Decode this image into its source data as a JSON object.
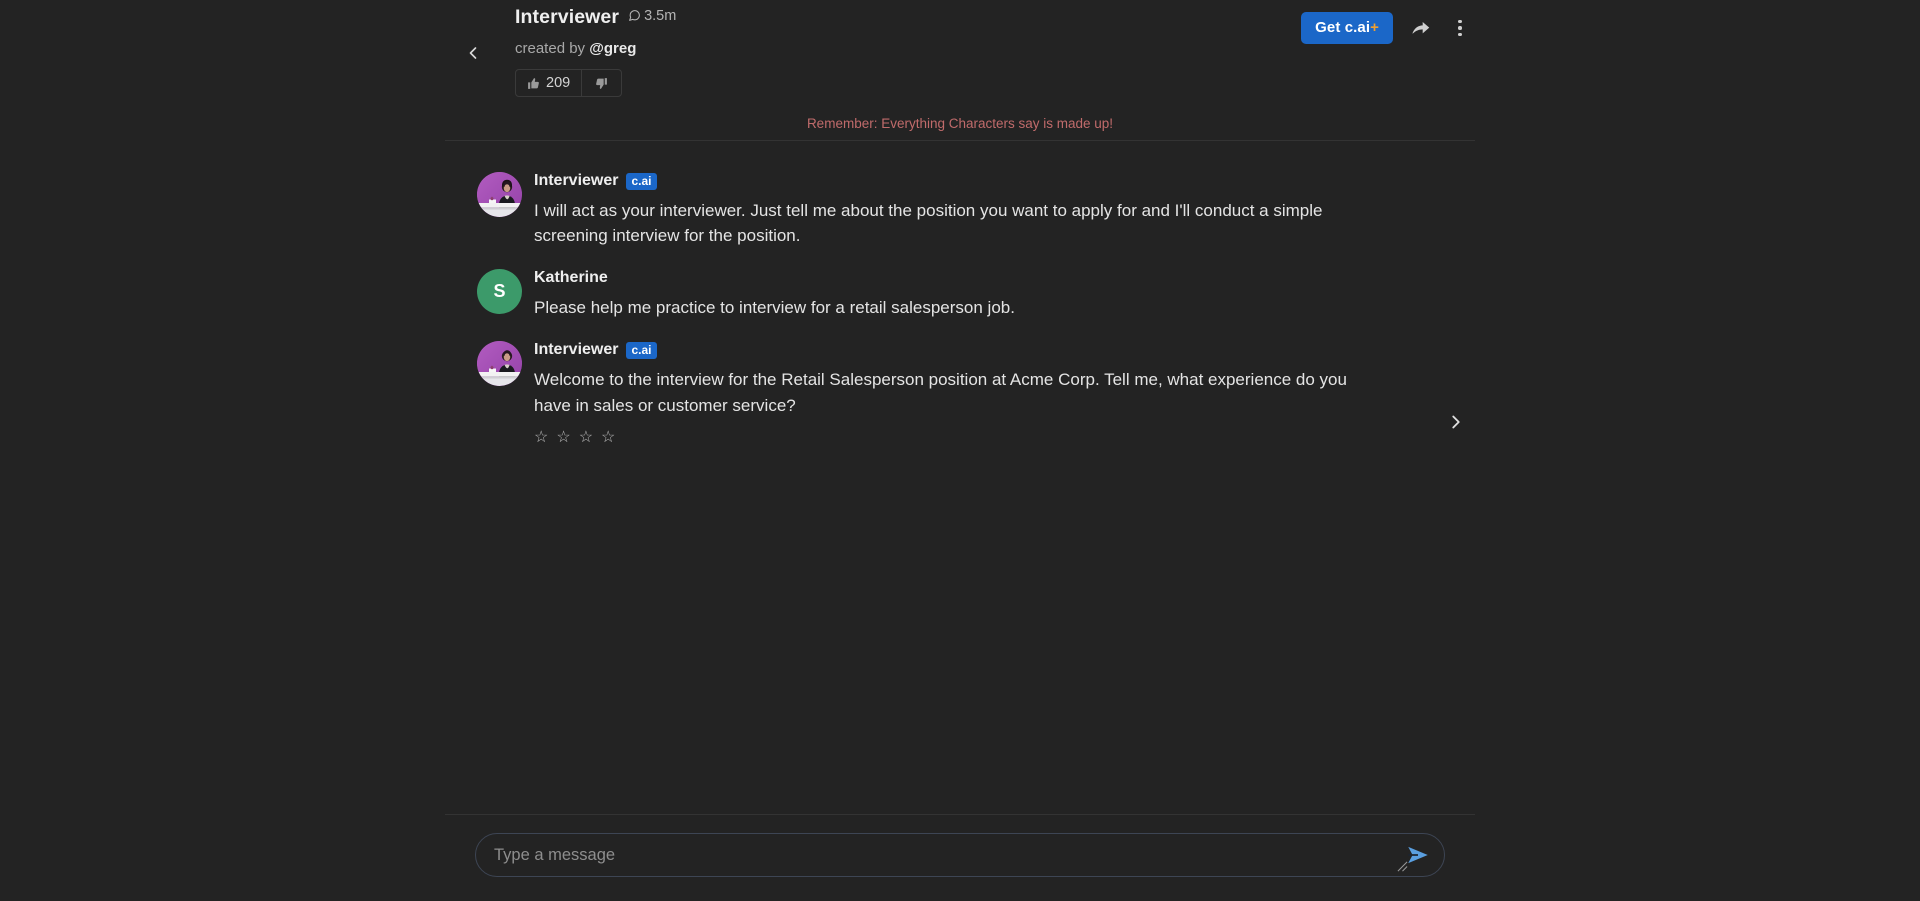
{
  "header": {
    "back_icon": "chevron-left-icon",
    "character_name": "Interviewer",
    "message_count_icon": "speech-bubble-icon",
    "message_count": "3.5m",
    "created_by_prefix": "created by ",
    "creator_handle": "@greg",
    "upvote_icon": "thumbs-up-icon",
    "upvote_count": "209",
    "downvote_icon": "thumbs-down-icon",
    "get_plus_label": "Get c.ai",
    "get_plus_plus": "+",
    "share_icon": "share-arrow-icon",
    "more_icon": "kebab-menu-icon",
    "accent_blue": "#1b67c8",
    "plus_gold": "#f0a030"
  },
  "disclaimer": {
    "text": "Remember: Everything Characters say is made up!",
    "color": "#c06b6b"
  },
  "messages": [
    {
      "author": "Interviewer",
      "badge": "c.ai",
      "avatar_type": "image",
      "avatar_color": "#a84fb8",
      "text": "I will act as your interviewer. Just tell me about the position you want to apply for and I'll conduct a simple screening interview for the position.",
      "has_rating": false
    },
    {
      "author": "Katherine",
      "badge": "",
      "avatar_type": "letter",
      "avatar_letter": "S",
      "avatar_color": "#3c9a6a",
      "text": "Please help me practice to interview for a retail salesperson job.",
      "has_rating": false
    },
    {
      "author": "Interviewer",
      "badge": "c.ai",
      "avatar_type": "image",
      "avatar_color": "#a84fb8",
      "text": "Welcome to the interview for the Retail Salesperson position at Acme Corp. Tell me, what experience do you have in sales or customer service?",
      "has_rating": true
    }
  ],
  "rating": {
    "stars": [
      "☆",
      "☆",
      "☆",
      "☆"
    ],
    "count": 4,
    "filled": 0
  },
  "swipe": {
    "next_icon": "chevron-right-icon"
  },
  "composer": {
    "placeholder": "Type a message",
    "value": "",
    "send_icon": "send-paper-plane-icon",
    "send_color": "#5a9fe0",
    "resize_icon": "resize-handle-icon"
  },
  "theme": {
    "background": "#232323",
    "divider": "#333333",
    "text_primary": "#e4e4e4",
    "text_muted": "#a8a8a8"
  }
}
